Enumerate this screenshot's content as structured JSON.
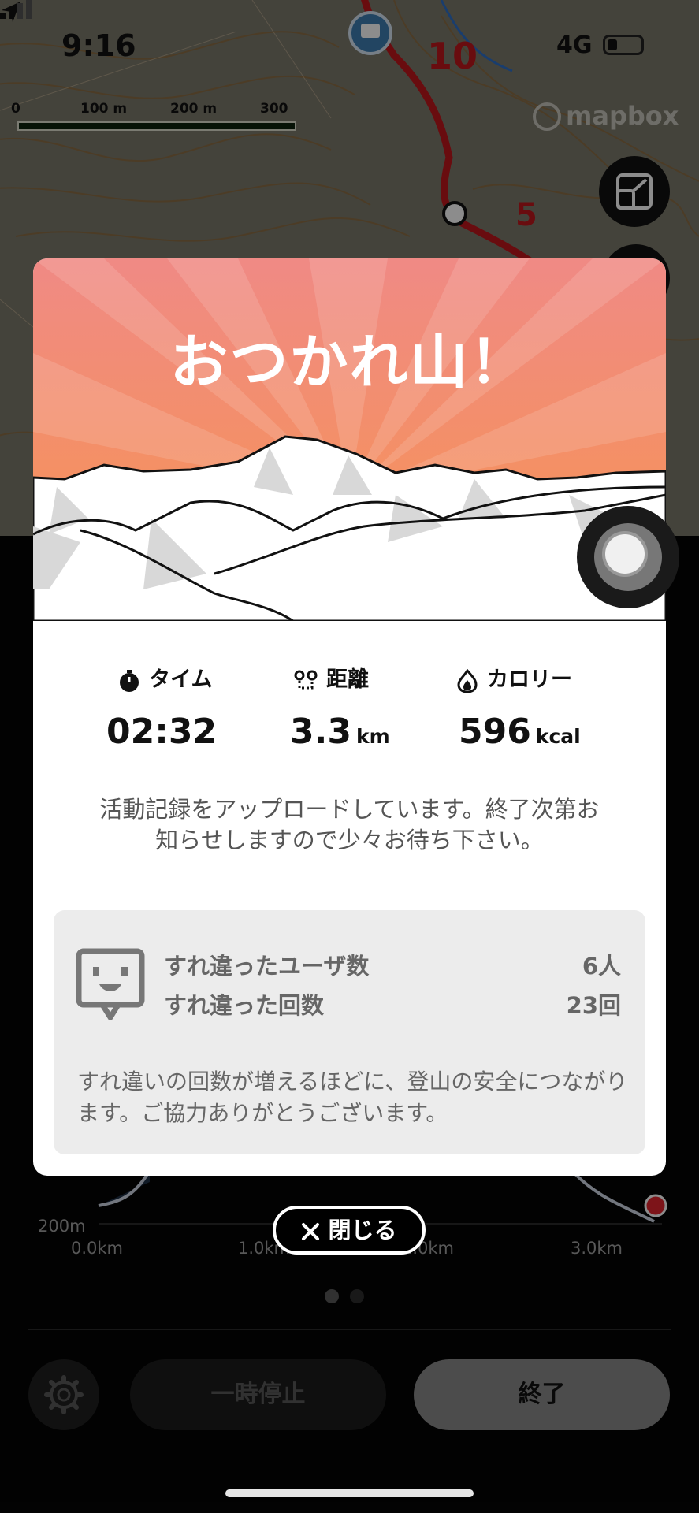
{
  "status_bar": {
    "time": "9:16",
    "network": "4G"
  },
  "map": {
    "scale_labels": [
      "0",
      "100 m",
      "200 m",
      "300 m"
    ],
    "attribution": "mapbox",
    "route_markers": [
      "10",
      "5"
    ]
  },
  "modal": {
    "title": "おつかれ山！",
    "stats": [
      {
        "label": "タイム",
        "value": "02:32",
        "unit": "",
        "icon": "stopwatch-icon"
      },
      {
        "label": "距離",
        "value": "3.3",
        "unit": "km",
        "icon": "route-icon"
      },
      {
        "label": "カロリー",
        "value": "596",
        "unit": "kcal",
        "icon": "flame-icon"
      }
    ],
    "upload_message": "活動記録をアップロードしています。終了次第お知らせしますので少々お待ち下さい。",
    "passing": {
      "users_label": "すれ違ったユーザ数",
      "users_value": "6人",
      "count_label": "すれ違った回数",
      "count_value": "23回",
      "note": "すれ違いの回数が増えるほどに、登山の安全につながります。ご協力ありがとうございます。"
    }
  },
  "close_button": {
    "label": "閉じる"
  },
  "elevation_chart": {
    "y_label": "200m",
    "x_labels": [
      "0.0km",
      "1.0km",
      "2.0km",
      "3.0km"
    ]
  },
  "controls": {
    "pause_label": "一時停止",
    "end_label": "終了"
  },
  "colors": {
    "hero_top": "#f08a7a",
    "hero_bottom": "#f5883a",
    "route": "#c0161c",
    "accent_red": "#e3262e"
  }
}
